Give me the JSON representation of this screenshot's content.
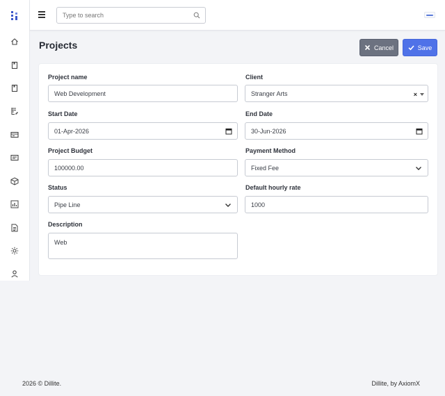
{
  "app": {
    "logo_icon": "dillite-logo-icon",
    "accent": "#4f72e8"
  },
  "sidebar": {
    "items": [
      {
        "name": "home",
        "icon": "home-icon"
      },
      {
        "name": "book",
        "icon": "book-icon"
      },
      {
        "name": "bookmark",
        "icon": "bookmark-icon"
      },
      {
        "name": "tasks",
        "icon": "edit-list-icon"
      },
      {
        "name": "invoices",
        "icon": "card-icon"
      },
      {
        "name": "expenses",
        "icon": "id-card-icon"
      },
      {
        "name": "products",
        "icon": "box-icon"
      },
      {
        "name": "reports",
        "icon": "bar-chart-icon"
      },
      {
        "name": "documents",
        "icon": "document-icon"
      },
      {
        "name": "settings",
        "icon": "gear-icon"
      },
      {
        "name": "profile",
        "icon": "user-icon"
      }
    ]
  },
  "header": {
    "search_placeholder": "Type to search"
  },
  "page": {
    "title": "Projects",
    "cancel_label": "Cancel",
    "save_label": "Save"
  },
  "form": {
    "project_name": {
      "label": "Project name",
      "value": "Web Development"
    },
    "client": {
      "label": "Client",
      "value": "Stranger Arts",
      "clear": "×"
    },
    "start_date": {
      "label": "Start Date",
      "value": "01-Apr-2026"
    },
    "end_date": {
      "label": "End Date",
      "value": "30-Jun-2026"
    },
    "budget": {
      "label": "Project Budget",
      "value": "100000.00"
    },
    "payment_method": {
      "label": "Payment Method",
      "value": "Fixed Fee"
    },
    "status": {
      "label": "Status",
      "value": "Pipe Line"
    },
    "hourly_rate": {
      "label": "Default hourly rate",
      "value": "1000"
    },
    "description": {
      "label": "Description",
      "value": "Web"
    }
  },
  "footer": {
    "left": "2026 © Dillite.",
    "right": "Dillite, by AxiomX"
  }
}
